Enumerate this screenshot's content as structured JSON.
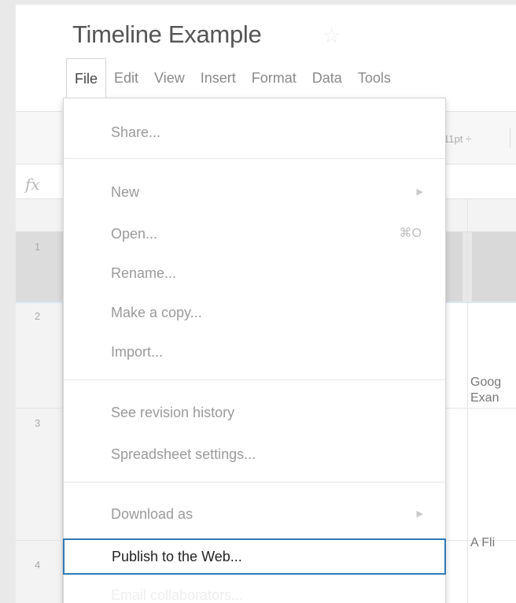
{
  "document": {
    "title": "Timeline Example",
    "star_icon": "star-icon"
  },
  "menubar": {
    "items": [
      "File",
      "Edit",
      "View",
      "Insert",
      "Format",
      "Data",
      "Tools"
    ],
    "active": "File"
  },
  "toolbar": {
    "font_size": "11pt ÷"
  },
  "formula_bar": {
    "fx_label": "fx"
  },
  "rows": [
    "1",
    "2",
    "3",
    "4"
  ],
  "cells": {
    "row2_col": "Goog",
    "row2_col_line2": "Exan",
    "row4_col": "A Fli"
  },
  "file_menu": {
    "share": "Share...",
    "new": "New",
    "open": "Open...",
    "open_shortcut": "⌘O",
    "rename": "Rename...",
    "make_copy": "Make a copy...",
    "import": "Import...",
    "revision_history": "See revision history",
    "settings": "Spreadsheet settings...",
    "download": "Download as",
    "publish": "Publish to the Web...",
    "email": "Email collaborators..."
  },
  "colors": {
    "highlight_border": "#2f7ab8"
  }
}
